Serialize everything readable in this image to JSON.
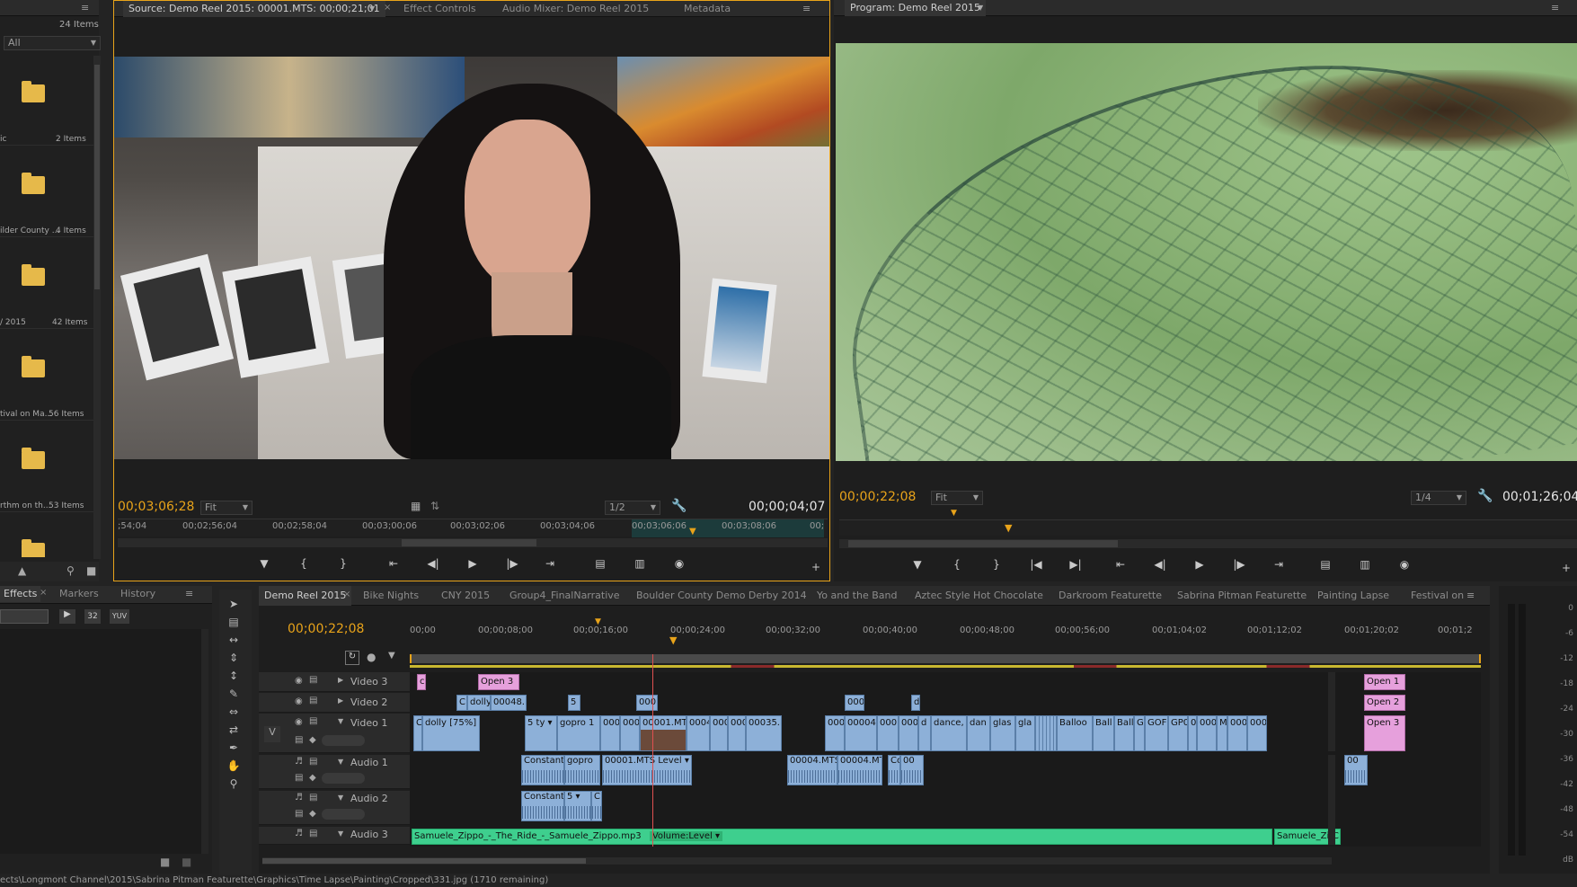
{
  "project": {
    "items_count": "24 Items",
    "filter": "All",
    "bins": [
      {
        "name": "ic",
        "count": "2 Items"
      },
      {
        "name": "ilder County ...",
        "count": "4 Items"
      },
      {
        "name": "/ 2015",
        "count": "42 Items"
      },
      {
        "name": "tival on Ma...",
        "count": "56 Items"
      },
      {
        "name": "rthm on th...",
        "count": "53 Items"
      },
      {
        "name": "",
        "count": ""
      }
    ]
  },
  "source": {
    "tabs": [
      "Source: Demo Reel 2015: 00001.MTS: 00;00;21;01",
      "Effect Controls",
      "Audio Mixer: Demo Reel 2015",
      "Metadata"
    ],
    "timecode_left": "00;03;06;28",
    "fit": "Fit",
    "resolution": "1/2",
    "timecode_right": "00;00;04;07",
    "ruler": [
      ";54;04",
      "00;02;56;04",
      "00;02;58;04",
      "00;03;00;06",
      "00;03;02;06",
      "00;03;04;06",
      "00;03;06;06",
      "00;03;08;06",
      "00;"
    ]
  },
  "program": {
    "tab": "Program: Demo Reel 2015",
    "timecode_left": "00;00;22;08",
    "fit": "Fit",
    "resolution": "1/4",
    "timecode_right": "00;01;26;04"
  },
  "effects": {
    "tabs": [
      "Effects",
      "Markers",
      "History"
    ],
    "badges": [
      "32",
      "YUV"
    ]
  },
  "timeline": {
    "tabs": [
      "Demo Reel 2015",
      "Bike Nights",
      "CNY 2015",
      "Group4_FinalNarrative",
      "Boulder County Demo Derby 2014",
      "Yo and the Band",
      "Aztec Style Hot Chocolate",
      "Darkroom Featurette",
      "Sabrina Pitman Featurette",
      "Painting Lapse",
      "Festival on"
    ],
    "timecode": "00;00;22;08",
    "ruler": [
      "00;00",
      "00;00;08;00",
      "00;00;16;00",
      "00;00;24;00",
      "00;00;32;00",
      "00;00;40;00",
      "00;00;48;00",
      "00;00;56;00",
      "00;01;04;02",
      "00;01;12;02",
      "00;01;20;02",
      "00;01;2"
    ],
    "tracks": {
      "video3": "Video 3",
      "video2": "Video 2",
      "video1": "Video 1",
      "audio1": "Audio 1",
      "audio2": "Audio 2",
      "audio3": "Audio 3",
      "v_patch": "V"
    },
    "clips_v3": [
      "c",
      "Open 3",
      "Open 1"
    ],
    "clips_v2": [
      "C",
      "dolly",
      "00048.M",
      "5",
      "000",
      "000",
      "d",
      "Open 2"
    ],
    "clips_v1": [
      "C",
      "dolly [75%]",
      "5 ty ▾",
      "gopro 1",
      "000",
      "000",
      "00001.MTS",
      "0004",
      "000",
      "000",
      "00035.N",
      "000",
      "00004.I",
      "000",
      "000",
      "d",
      "dance, f",
      "dan",
      "glas",
      "gla",
      "Balloo",
      "Ball",
      "Ball",
      "G",
      "GOF",
      "GP0",
      "0",
      "000",
      "M",
      "000",
      "000",
      "Open 3"
    ],
    "clips_a1": [
      "Constant",
      "gopro",
      "00001.MTS  Level ▾",
      "00004.MTS",
      "00004.MT",
      "Co",
      "00",
      "00"
    ],
    "clips_a2": [
      "Constant",
      "5 ▾",
      "C"
    ],
    "clip_a3_main": "Samuele_Zippo_-_The_Ride_-_Samuele_Zippo.mp3",
    "clip_a3_level": "Volume:Level ▾",
    "clip_a3_end": "Samuele_Zip",
    "clip_a3_end2": "C"
  },
  "meter_labels": [
    "0",
    "-6",
    "-12",
    "-18",
    "-24",
    "-30",
    "-36",
    "-42",
    "-48",
    "-54",
    "dB"
  ],
  "status_bar": "ects\\Longmont Channel\\2015\\Sabrina Pitman Featurette\\Graphics\\Time Lapse\\Painting\\Cropped\\331.jpg (1710 remaining)",
  "colors": {
    "accent_orange": "#e8a31a",
    "clip_blue": "#8db0d8",
    "clip_pink": "#e6a0dc",
    "audio_green": "#3ecf8e"
  }
}
